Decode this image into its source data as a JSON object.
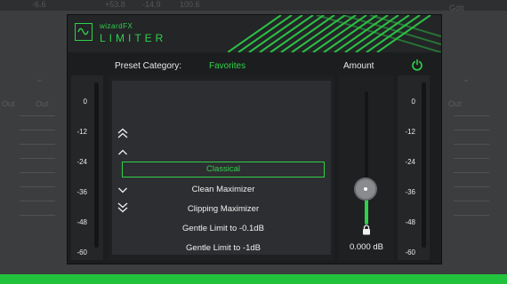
{
  "background": {
    "top_values": [
      "-6.6",
      "+53.8",
      "-14.9",
      "100.6",
      "Gdit"
    ],
    "side_labels": [
      "Out",
      "Out",
      "Out"
    ]
  },
  "plugin": {
    "brand": "wizardFX",
    "product": "LIMITER",
    "accent_color": "#2ed24a",
    "preset_category_label": "Preset Category:",
    "preset_category_value": "Favorites",
    "amount_label": "Amount",
    "amount_value": "0.000 dB",
    "amount_level": 0.27,
    "meter_ticks": [
      "0",
      "-12",
      "-24",
      "-36",
      "-48",
      "-60"
    ],
    "presets": [
      {
        "label": "Classical",
        "selected": true
      },
      {
        "label": "Clean Maximizer",
        "selected": false
      },
      {
        "label": "Clipping Maximizer",
        "selected": false
      },
      {
        "label": "Gentle Limit to -0.1dB",
        "selected": false
      },
      {
        "label": "Gentle Limit to -1dB",
        "selected": false
      }
    ],
    "icons": {
      "logo": "waveform-logo-icon",
      "power": "power-icon",
      "lock": "lock-icon",
      "nav": [
        "double-chevron-up-icon",
        "chevron-up-icon",
        "chevron-down-icon",
        "double-chevron-down-icon"
      ]
    }
  }
}
